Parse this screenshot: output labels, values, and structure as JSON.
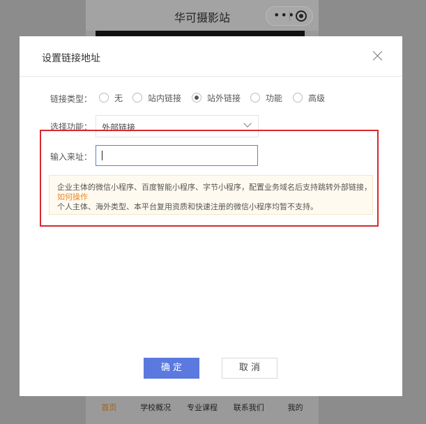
{
  "background": {
    "title": "华可摄影站",
    "capsule_dots": "•••",
    "tabs": [
      {
        "label": "首页",
        "active": true
      },
      {
        "label": "学校概况",
        "active": false
      },
      {
        "label": "专业课程",
        "active": false
      },
      {
        "label": "联系我们",
        "active": false
      },
      {
        "label": "我的",
        "active": false
      }
    ]
  },
  "dialog": {
    "title": "设置链接地址",
    "link_type_label": "链接类型：",
    "link_types": [
      {
        "label": "无",
        "checked": false
      },
      {
        "label": "站内链接",
        "checked": false
      },
      {
        "label": "站外链接",
        "checked": true
      },
      {
        "label": "功能",
        "checked": false
      },
      {
        "label": "高级",
        "checked": false
      }
    ],
    "function_label": "选择功能：",
    "function_value": "外部链接",
    "url_label": "输入来址：",
    "url_value": "",
    "notice": {
      "line1": "企业主体的微信小程序、百度智能小程序、字节小程序，配置业务域名后支持跳转外部链接，",
      "link": "如何操作",
      "line3": "个人主体、海外类型、本平台复用资质和快速注册的微信小程序均暂不支持。"
    },
    "confirm_label": "确 定",
    "cancel_label": "取 消"
  },
  "colors": {
    "primary": "#5b79de",
    "highlight": "#d9272e",
    "notice_link": "#f0841d",
    "notice_bg": "#fffaef"
  }
}
